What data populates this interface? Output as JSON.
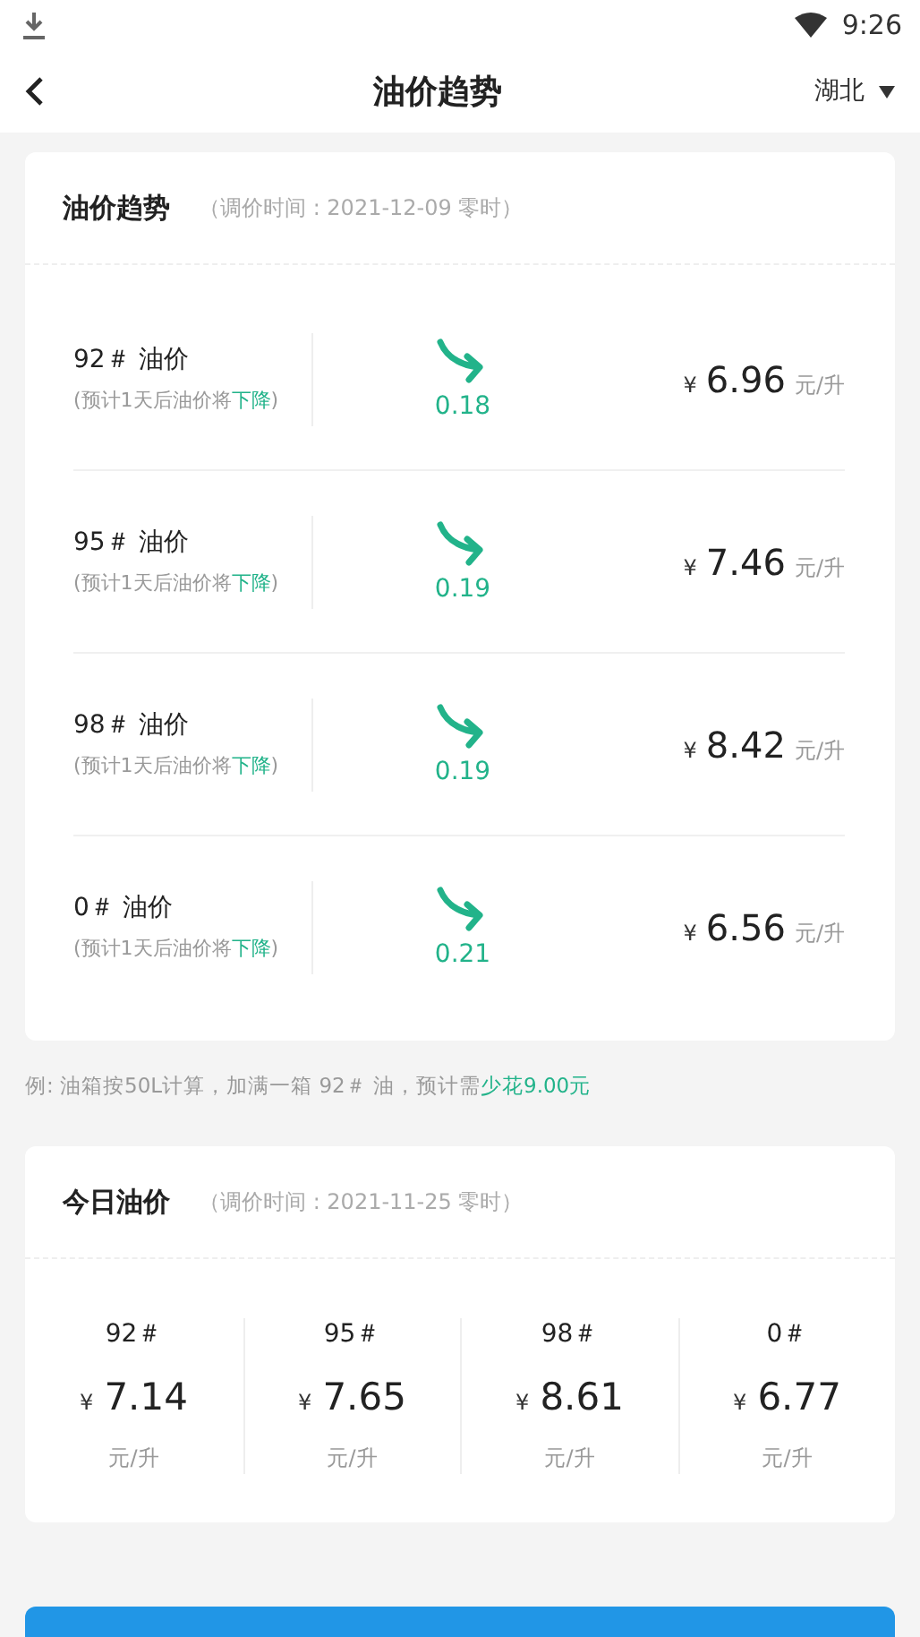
{
  "status_bar": {
    "time": "9:26"
  },
  "header": {
    "title": "油价趋势",
    "region": "湖北"
  },
  "trend_card": {
    "title": "油价趋势",
    "subtitle": "（调价时间 : 2021-12-09 零时）",
    "rows": [
      {
        "name": "92＃ 油价",
        "hint_before": "(预计1天后油价将",
        "hint_trend": "下降",
        "hint_after": ")",
        "kind": "down",
        "change": "0.18",
        "currency": "¥",
        "price": "6.96",
        "unit": "元/升"
      },
      {
        "name": "95＃ 油价",
        "hint_before": "(预计1天后油价将",
        "hint_trend": "下降",
        "hint_after": ")",
        "kind": "down",
        "change": "0.19",
        "currency": "¥",
        "price": "7.46",
        "unit": "元/升"
      },
      {
        "name": "98＃ 油价",
        "hint_before": "(预计1天后油价将",
        "hint_trend": "下降",
        "hint_after": ")",
        "kind": "down",
        "change": "0.19",
        "currency": "¥",
        "price": "8.42",
        "unit": "元/升"
      },
      {
        "name": "0＃ 油价",
        "hint_before": "(预计1天后油价将",
        "hint_trend": "下降",
        "hint_after": ")",
        "kind": "down",
        "change": "0.21",
        "currency": "¥",
        "price": "6.56",
        "unit": "元/升"
      }
    ]
  },
  "tip": {
    "text": "例: 油箱按50L计算，加满一箱 92＃ 油，预计需",
    "highlight": "少花9.00元"
  },
  "today_card": {
    "title": "今日油价",
    "subtitle": "（调价时间 : 2021-11-25 零时）",
    "columns": [
      {
        "grade": "92＃",
        "currency": "¥",
        "price": "7.14",
        "unit": "元/升"
      },
      {
        "grade": "95＃",
        "currency": "¥",
        "price": "7.65",
        "unit": "元/升"
      },
      {
        "grade": "98＃",
        "currency": "¥",
        "price": "8.61",
        "unit": "元/升"
      },
      {
        "grade": "0＃",
        "currency": "¥",
        "price": "6.77",
        "unit": "元/升"
      }
    ]
  }
}
